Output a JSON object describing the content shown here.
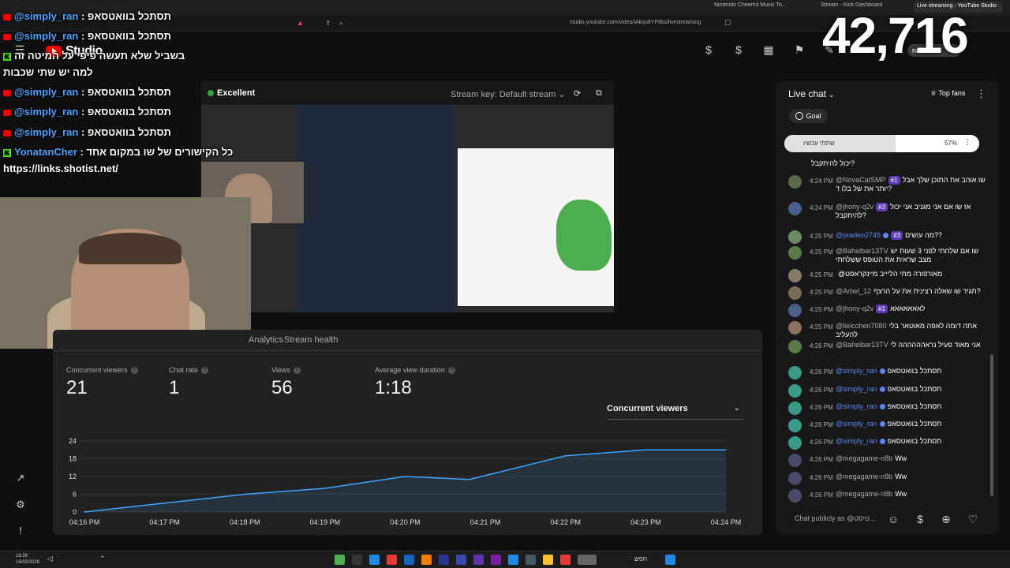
{
  "browser": {
    "tabs": [
      {
        "label": "Nintendo Cheerful Music To...",
        "active": false
      },
      {
        "label": "Stream - Kick Dashboard",
        "active": false
      },
      {
        "label": "Live streaming - YouTube Studio",
        "active": true
      }
    ],
    "url": "studio.youtube.com/video/iAkqu6YP8ks/livestreaming"
  },
  "header": {
    "logo_label": "Studio",
    "end_stream_label": "nd Strea"
  },
  "overlay": {
    "viewer_count": "42,716",
    "chat_lines": [
      {
        "name": "@simply_ran",
        "sep": " : ",
        "msg": "תסתכל בוואטסאפ",
        "platform": "youtube"
      },
      {
        "name": "@simply_ran",
        "sep": " : ",
        "msg": "תסתכל בוואטסאפ",
        "platform": "youtube"
      },
      {
        "name": "",
        "sep": "",
        "msg": "בשביל שלא תעשה פיפי על המיטה זה",
        "platform": "kick"
      },
      {
        "name": "",
        "sep": "",
        "msg": "למה יש שתי שכבות",
        "platform": "none"
      },
      {
        "name": "@simply_ran",
        "sep": " : ",
        "msg": "תסתכל בוואטסאפ",
        "platform": "youtube"
      },
      {
        "name": "@simply_ran",
        "sep": " : ",
        "msg": "תסתכל בוואטסאפ",
        "platform": "youtube"
      },
      {
        "name": "@simply_ran",
        "sep": " : ",
        "msg": "תסתכל בוואטסאפ",
        "platform": "youtube"
      },
      {
        "name": "YonatanCher",
        "sep": " : ",
        "msg": "כל הקישורים של שו במקום אחד",
        "platform": "kick"
      },
      {
        "name": "",
        "sep": "",
        "msg": "https://links.shotist.net/",
        "platform": "none"
      }
    ]
  },
  "preview": {
    "quality_label": "Excellent",
    "stream_key_label": "Stream key: Default stream"
  },
  "analytics": {
    "tabs": [
      {
        "label": "Analytics",
        "active": false
      },
      {
        "label": "Stream health",
        "active": false
      }
    ],
    "metrics": [
      {
        "label": "Concurrent viewers",
        "value": "21"
      },
      {
        "label": "Chat rate",
        "value": "1"
      },
      {
        "label": "Views",
        "value": "56"
      },
      {
        "label": "Average view duration",
        "value": "1:18"
      }
    ],
    "chart_selector": "Concurrent viewers"
  },
  "chart_data": {
    "type": "area",
    "title": "",
    "xlabel": "",
    "ylabel": "",
    "ylim": [
      0,
      24
    ],
    "yticks": [
      0,
      6,
      12,
      18,
      24
    ],
    "x_tick_labels": [
      "04:16 PM",
      "04:17 PM",
      "04:18 PM",
      "04:19 PM",
      "04:20 PM",
      "04:21 PM",
      "04:22 PM",
      "04:23 PM",
      "04:24 PM"
    ],
    "x": [
      0,
      1,
      2,
      3,
      4,
      4.8,
      5.1,
      6,
      7,
      8
    ],
    "series": [
      {
        "values": [
          0,
          3,
          6,
          8,
          12,
          11,
          13,
          19,
          21,
          21
        ]
      }
    ],
    "color": "#3ea6ff",
    "grid": true
  },
  "chat": {
    "title": "Live chat",
    "top_fans_label": "Top fans",
    "goal_label": "Goal",
    "goal_text": "שתתי עכשיו",
    "goal_percent": "57%",
    "goal_fraction": 0.57,
    "input_placeholder": "Chat publicly as @טיסט...",
    "partial_top": "יכול להיתקבל?",
    "messages": [
      {
        "time": "4:24 PM",
        "author": "@NovaCatSMP",
        "badge": "#1",
        "text": "שו אוהב את התוכן שלך אבל יותר את של בלו ד?",
        "mod": false,
        "verified": false
      },
      {
        "time": "4:24 PM",
        "author": "@jhony-q2v",
        "badge": "#3",
        "text": "אז שו אם אני מגניב אני יכול להיתקבל?",
        "mod": false,
        "verified": false
      },
      {
        "time": "4:25 PM",
        "author": "@pradeo2745",
        "badge": "#3",
        "text": "מה עושים??",
        "mod": true,
        "verified": true
      },
      {
        "time": "4:25 PM",
        "author": "@Bahelbar13TV",
        "badge": "",
        "text": "שו אם שלחתי לפני 3 שעות יש מצב שראית את הטופס ששלחתי",
        "mod": false,
        "verified": false
      },
      {
        "time": "4:25 PM",
        "author": "",
        "badge": "",
        "text": "@מאורפורה מתי הליייב מיינקראפט",
        "mod": false,
        "verified": false
      },
      {
        "time": "4:25 PM",
        "author": "@Arbel_12",
        "badge": "",
        "text": "תגיד שו שאלה רצינית את על הרצף?",
        "mod": false,
        "verified": false
      },
      {
        "time": "4:25 PM",
        "author": "@jhony-q2v",
        "badge": "#1",
        "text": "לאאאאאאא",
        "mod": false,
        "verified": false
      },
      {
        "time": "4:25 PM",
        "author": "@lielcohen7080",
        "badge": "",
        "text": "אתה דומה לאפה מאוטאר בלי להעליב",
        "mod": false,
        "verified": false
      },
      {
        "time": "4:26 PM",
        "author": "@Bahelbar13TV",
        "badge": "",
        "text": "אני מאוד פעיל נראהההההה לי",
        "mod": false,
        "verified": false
      },
      {
        "time": "4:26 PM",
        "author": "@simply_ran",
        "badge": "",
        "text": "תסתכל בוואטסאפ",
        "mod": true,
        "verified": true
      },
      {
        "time": "4:26 PM",
        "author": "@simply_ran",
        "badge": "",
        "text": "תסתכל בוואטסאפ",
        "mod": true,
        "verified": true
      },
      {
        "time": "4:26 PM",
        "author": "@simply_ran",
        "badge": "",
        "text": "תסתכל בוואטסאפ",
        "mod": true,
        "verified": true
      },
      {
        "time": "4:26 PM",
        "author": "@simply_ran",
        "badge": "",
        "text": "תסתכל בוואטסאפ",
        "mod": true,
        "verified": true
      },
      {
        "time": "4:26 PM",
        "author": "@simply_ran",
        "badge": "",
        "text": "תסתכל בוואטסאפ",
        "mod": true,
        "verified": true
      },
      {
        "time": "4:26 PM",
        "author": "@megagame-n8b",
        "badge": "",
        "text": "Ww",
        "mod": false,
        "verified": false
      },
      {
        "time": "4:26 PM",
        "author": "@megagame-n8b",
        "badge": "",
        "text": "Ww",
        "mod": false,
        "verified": false
      },
      {
        "time": "4:26 PM",
        "author": "@megagame-n8b",
        "badge": "",
        "text": "Ww",
        "mod": false,
        "verified": false
      }
    ]
  },
  "taskbar": {
    "time": "16:26",
    "date": "16/03/2026",
    "search_label": "חפש"
  }
}
